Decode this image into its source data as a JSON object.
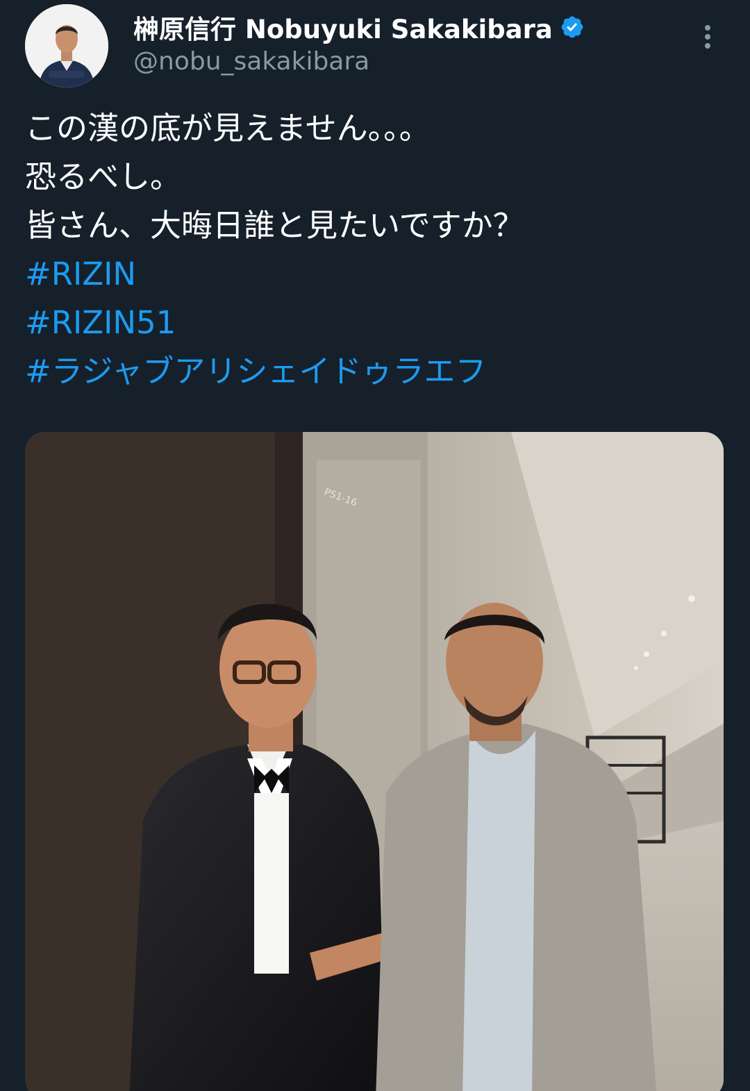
{
  "author": {
    "display_name": "榊原信行 Nobuyuki Sakakibara",
    "handle": "@nobu_sakakibara",
    "verified": true,
    "verified_color": "#1d9bf0"
  },
  "tweet": {
    "lines": [
      "この漢の底が見えません。。。",
      "恐るべし。",
      "皆さん、大晦日誰と見たいですか？"
    ],
    "hashtags": [
      "#RIZIN",
      "#RIZIN51",
      "#ラジャブアリシェイドゥラエフ"
    ],
    "hashtag_color": "#1d9bf0"
  },
  "media": {
    "door_sign": "PS1-16"
  },
  "icons": {
    "more": "more-vertical-icon",
    "verified": "verified-badge-icon"
  },
  "colors": {
    "background": "#15202b",
    "secondary_text": "#8b98a5"
  }
}
